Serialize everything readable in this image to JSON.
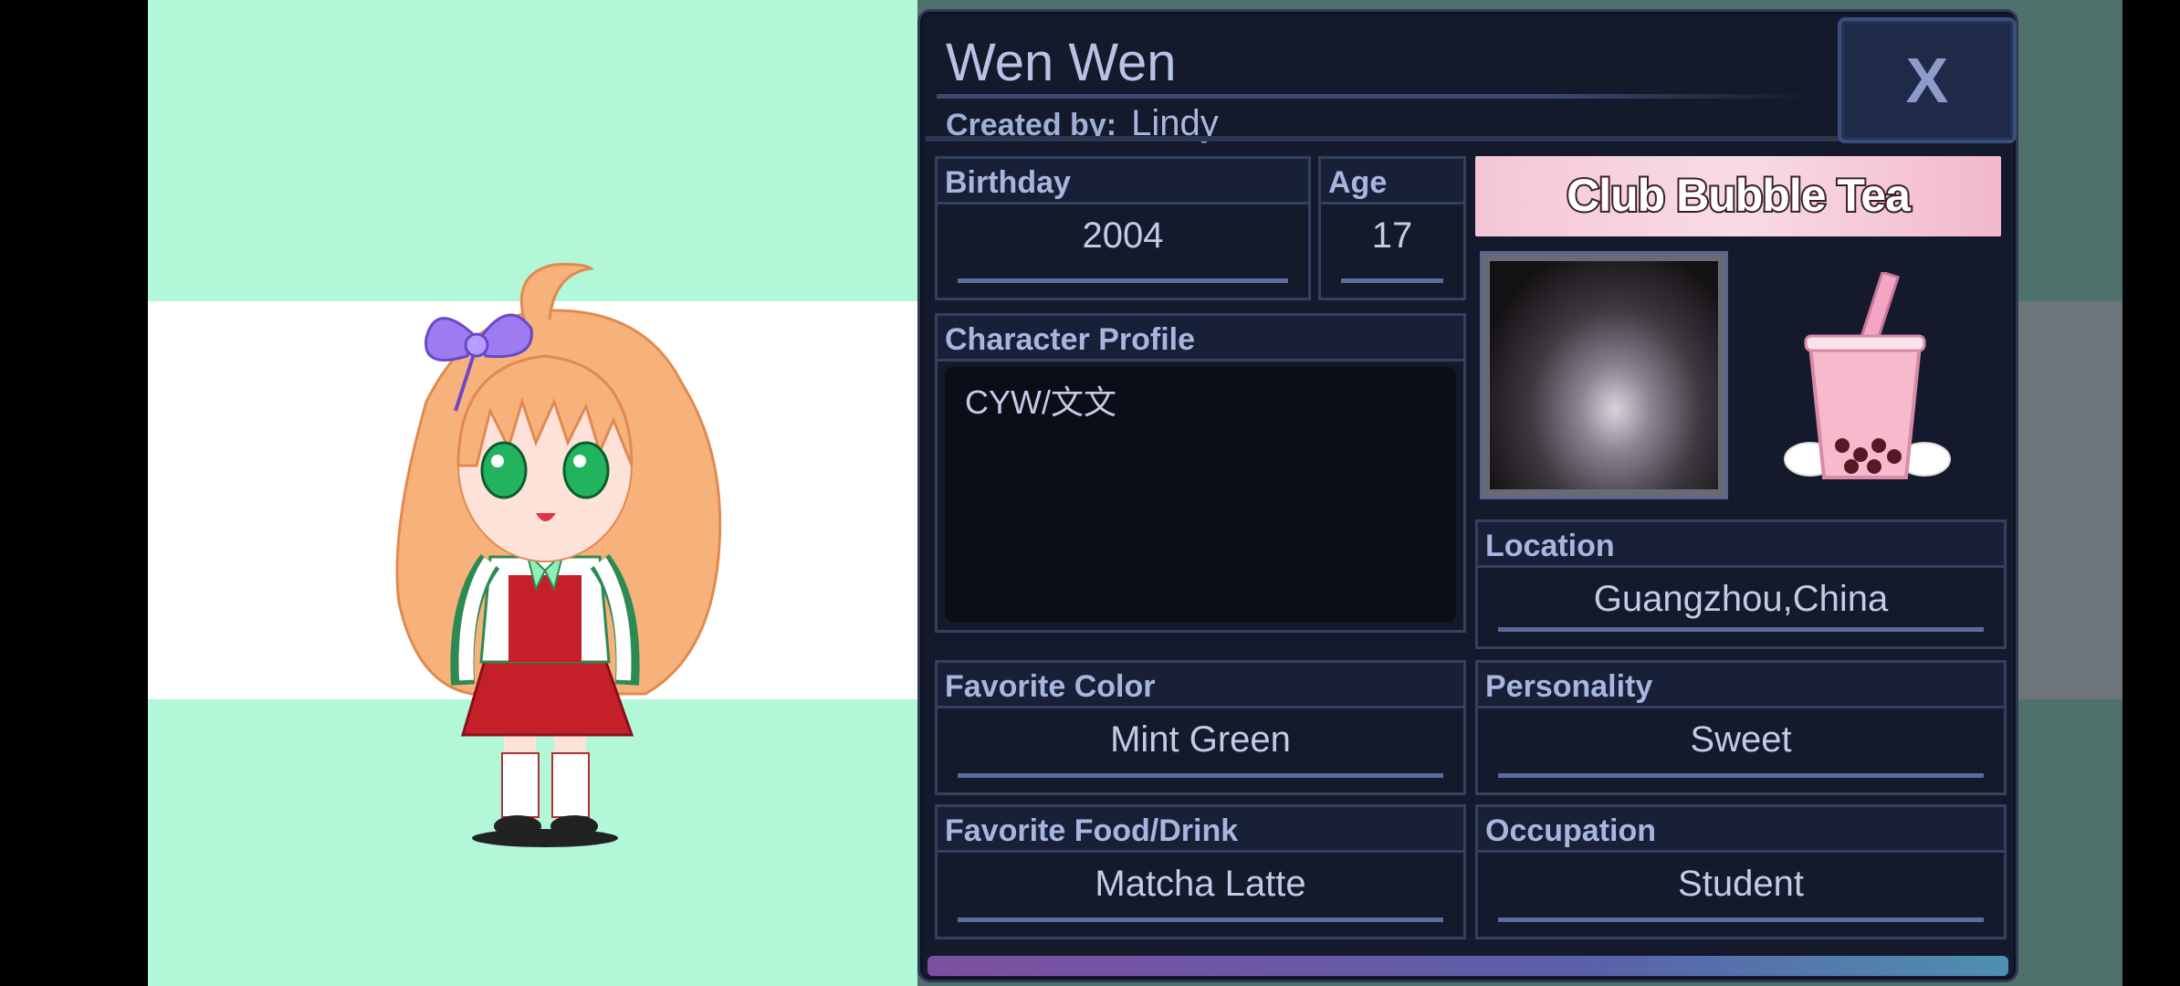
{
  "character": {
    "name": "Wen Wen",
    "created_by_label": "Created by:",
    "created_by": "Lindy"
  },
  "close_label": "X",
  "fields": {
    "birthday": {
      "label": "Birthday",
      "value": "2004"
    },
    "age": {
      "label": "Age",
      "value": "17"
    },
    "profile": {
      "label": "Character Profile",
      "value": "CYW/文文"
    },
    "location": {
      "label": "Location",
      "value": "Guangzhou,China"
    },
    "favorite_color": {
      "label": "Favorite Color",
      "value": "Mint Green"
    },
    "personality": {
      "label": "Personality",
      "value": "Sweet"
    },
    "favorite_food": {
      "label": "Favorite Food/Drink",
      "value": "Matcha Latte"
    },
    "occupation": {
      "label": "Occupation",
      "value": "Student"
    }
  },
  "banner_text": "Club Bubble Tea",
  "colors": {
    "mint": "#b1f7d8",
    "white_band": "#ffffff",
    "panel": "#141a2b",
    "accent": "#8d9bc8"
  },
  "icons": [
    "close-icon",
    "bubble-tea-icon"
  ]
}
